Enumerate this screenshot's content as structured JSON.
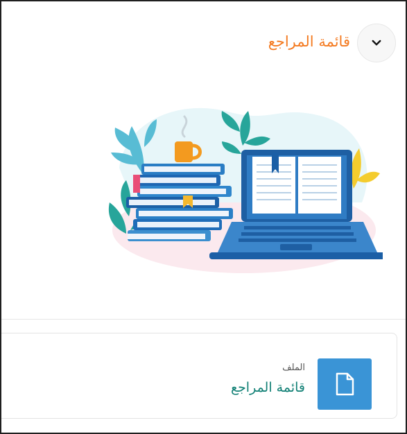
{
  "header": {
    "title": "قائمة المراجع",
    "toggle_icon": "chevron-down-icon"
  },
  "illustration": {
    "name": "books-and-laptop-illustration"
  },
  "resource": {
    "type_label": "الملف",
    "name": "قائمة المراجع",
    "icon": "file-icon"
  },
  "colors": {
    "title": "#f47a20",
    "file_icon_bg": "#3a94d6",
    "link": "#0f7f74"
  }
}
